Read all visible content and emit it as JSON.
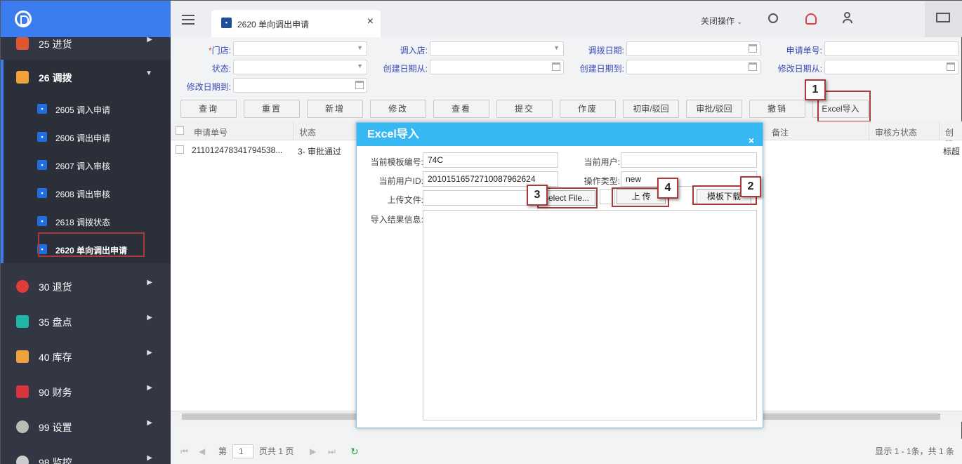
{
  "tab": {
    "title": "2620 单向调出申请"
  },
  "topbar": {
    "close_ops": "关闭操作"
  },
  "sidebar": {
    "menus": [
      {
        "label": "25 进货"
      },
      {
        "label": "26 调拨"
      },
      {
        "label": "30 退货"
      },
      {
        "label": "35 盘点"
      },
      {
        "label": "40 库存"
      },
      {
        "label": "90 财务"
      },
      {
        "label": "99 设置"
      },
      {
        "label": "98 监控"
      }
    ],
    "subitems": [
      {
        "label": "2605 调入申请"
      },
      {
        "label": "2606 调出申请"
      },
      {
        "label": "2607 调入审核"
      },
      {
        "label": "2608 调出审核"
      },
      {
        "label": "2618 调拨状态"
      },
      {
        "label": "2620 单向调出申请"
      }
    ]
  },
  "filters": {
    "store_req": "*",
    "store": "门店:",
    "in_store": "调入店:",
    "transfer_date": "调拨日期:",
    "apply_no": "申请单号:",
    "status": "状态:",
    "create_from": "创建日期从:",
    "create_to": "创建日期到:",
    "modify_from": "修改日期从:",
    "modify_to": "修改日期到:"
  },
  "buttons": {
    "query": "查询",
    "reset": "重置",
    "add": "新增",
    "edit": "修改",
    "view": "查看",
    "submit": "提交",
    "void": "作废",
    "first_review": "初审/驳回",
    "approve": "审批/驳回",
    "revoke": "撤销",
    "excel_import": "Excel导入"
  },
  "grid": {
    "headers": {
      "apply_no": "申请单号",
      "status": "状态",
      "remark": "备注",
      "audit_status": "审核方状态",
      "create": "创建"
    },
    "row": {
      "apply_no": "211012478341794538...",
      "status": "3- 审批通过",
      "create": "标超"
    }
  },
  "pager": {
    "page_prefix": "第",
    "page": "1",
    "page_suffix": "页共 1 页",
    "summary": "显示 1 - 1条，共 1 条"
  },
  "dialog": {
    "title": "Excel导入",
    "close": "×",
    "template_no_label": "当前模板编号:",
    "template_no": "74C",
    "current_user_label": "当前用户:",
    "current_user": "",
    "user_id_label": "当前用户ID:",
    "user_id": "2010151657271008796262​4",
    "op_type_label": "操作类型:",
    "op_type": "new",
    "upload_file_label": "上传文件:",
    "select_file": "Select File...",
    "upload": "上 传",
    "template_download": "模板下载",
    "result_label": "导入结果信息:"
  },
  "callouts": {
    "n1": "1",
    "n2": "2",
    "n3": "3",
    "n4": "4"
  },
  "colors": {
    "sidebar": "#333744",
    "brand": "#3b7cf0",
    "dialog_header": "#36b9f3",
    "callout": "#a93a3a"
  }
}
